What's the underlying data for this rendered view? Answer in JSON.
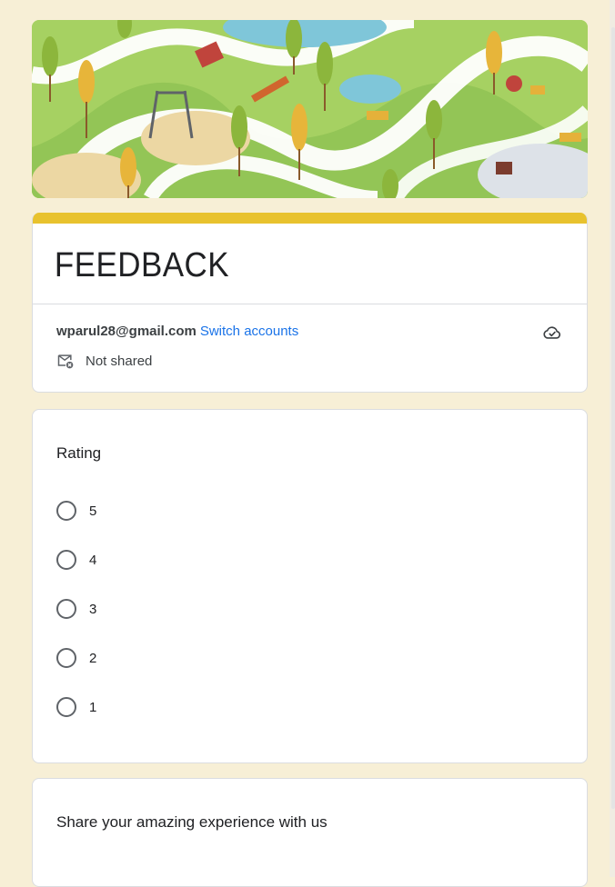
{
  "form": {
    "title": "FEEDBACK",
    "accent_color": "#e8c22e"
  },
  "account": {
    "email": "wparul28@gmail.com",
    "switch_label": "Switch accounts",
    "cloud_icon": "cloud-check-icon",
    "shared_icon": "mail-not-shared-icon",
    "shared_status": "Not shared"
  },
  "question_rating": {
    "label": "Rating",
    "options": [
      "5",
      "4",
      "3",
      "2",
      "1"
    ]
  },
  "question_experience": {
    "label": "Share your amazing experience with us"
  },
  "banner": {
    "icon": "park-illustration"
  }
}
